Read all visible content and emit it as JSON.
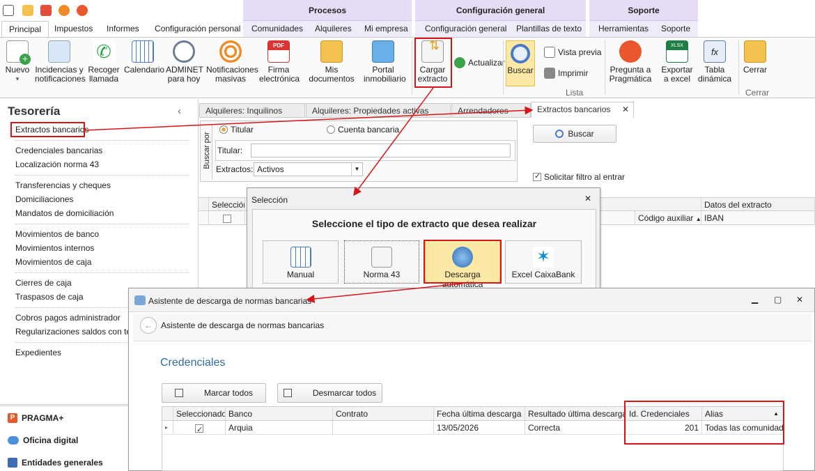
{
  "ribbon_groups": {
    "procesos": "Procesos",
    "configuracion": "Configuración general",
    "soporte": "Soporte"
  },
  "tabs": [
    "Principal",
    "Impuestos",
    "Informes",
    "Configuración personal",
    "Comunidades",
    "Alquileres",
    "Mi empresa",
    "Configuración general",
    "Plantillas de texto",
    "Herramientas",
    "Soporte"
  ],
  "ribbon": {
    "nuevo": "Nuevo",
    "incidencias": [
      "Incidencias y",
      "notificaciones"
    ],
    "recoger": [
      "Recoger",
      "llamada"
    ],
    "calendario": "Calendario",
    "adminet": [
      "ADMINET",
      "para hoy"
    ],
    "notificaciones": [
      "Notificaciones",
      "masivas"
    ],
    "firma": [
      "Firma",
      "electrónica"
    ],
    "mis_documentos": "Mis documentos",
    "portal": [
      "Portal",
      "inmobiliario"
    ],
    "cargar": [
      "Cargar",
      "extracto"
    ],
    "actualizar": "Actualizar",
    "buscar": "Buscar",
    "vista_previa": "Vista previa",
    "imprimir": "Imprimir",
    "lista_caption": "Lista",
    "pregunta": [
      "Pregunta a",
      "Pragmática"
    ],
    "exportar": [
      "Exportar",
      "a excel"
    ],
    "tabla": [
      "Tabla",
      "dinámica"
    ],
    "cerrar": "Cerrar",
    "cerrar_caption": "Cerrar"
  },
  "sidebar": {
    "title": "Tesorería",
    "collapse": "‹",
    "items": [
      "Extractos bancarios",
      "Credenciales bancarias",
      "Localización norma 43",
      "Transferencias y cheques",
      "Domiciliaciones",
      "Mandatos de domiciliación",
      "Movimientos de banco",
      "Movimientos internos",
      "Movimientos de caja",
      "Cierres de caja",
      "Traspasos de caja",
      "Cobros pagos administrador",
      "Regularizaciones saldos con terce",
      "Expedientes"
    ],
    "bottom": [
      "PRAGMA+",
      "Oficina digital",
      "Entidades generales"
    ]
  },
  "doc_tabs": [
    "Alquileres: Inquilinos",
    "Alquileres: Propiedades activas",
    "Arrendadores",
    "Extractos bancarios"
  ],
  "search": {
    "buscar_por": "Buscar por",
    "radio_titular": "Titular",
    "radio_cuenta": "Cuenta bancaria",
    "titular_label": "Titular:",
    "titular_value": "",
    "extractos_label": "Extractos:",
    "extractos_value": "Activos",
    "buscar_btn": "Buscar",
    "solicitar": "Solicitar filtro al entrar"
  },
  "grid": {
    "seleccion": "Selección",
    "datos": "Datos del extracto",
    "codigo": "Código auxiliar",
    "iban": "IBAN"
  },
  "seleccion_dialog": {
    "title": "Selección",
    "heading": "Seleccione el tipo de extracto que desea realizar",
    "tiles": [
      "Manual",
      "Norma 43",
      "Descarga automática",
      "Excel CaixaBank"
    ]
  },
  "asistente": {
    "window_title": "Asistente de descarga de normas bancarias",
    "header": "Asistente de descarga de normas bancarias",
    "section": "Credenciales",
    "marcar": "Marcar todos",
    "desmarcar": "Desmarcar todos",
    "columns": [
      "Seleccionado",
      "Banco",
      "Contrato",
      "Fecha última descarga",
      "Resultado última descarga",
      "Id. Credenciales",
      "Alias"
    ],
    "row": {
      "banco": "Arquia",
      "contrato": "",
      "fecha": "13/05/2026",
      "resultado": "Correcta",
      "id": "201",
      "alias": "Todas las comunidades"
    }
  },
  "colors": {
    "accent_red": "#d7141a",
    "group_purple": "#e6dcf5",
    "link_blue": "#2e6da4"
  }
}
